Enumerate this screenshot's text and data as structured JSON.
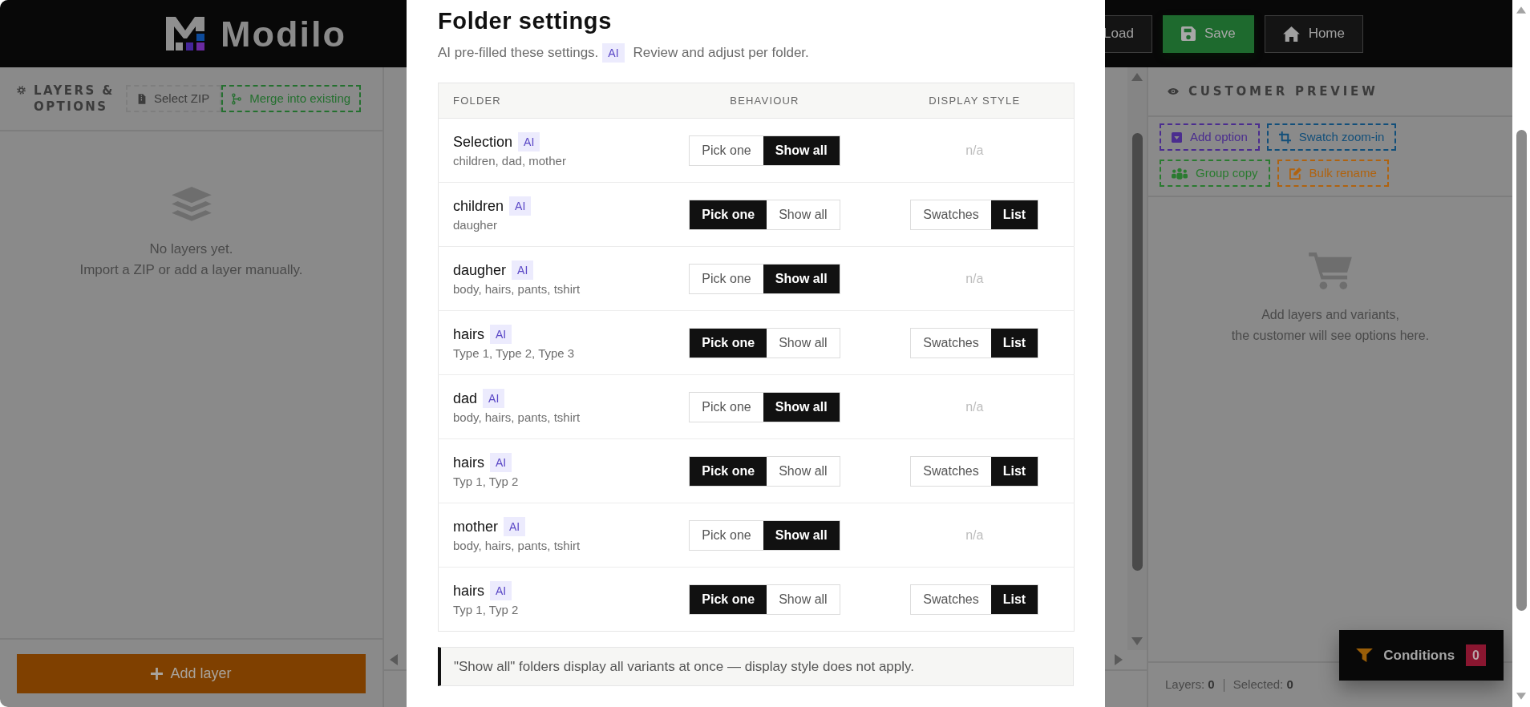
{
  "header": {
    "logo": "Modilo",
    "buttons": [
      {
        "label": "Load",
        "kind": "load"
      },
      {
        "label": "Save",
        "kind": "save"
      },
      {
        "label": "Home",
        "kind": "home"
      }
    ]
  },
  "layers_panel": {
    "title": "LAYERS & OPTIONS",
    "actions": [
      {
        "label": "Select ZIP",
        "kind": "zip"
      },
      {
        "label": "Merge into existing",
        "kind": "merge"
      }
    ],
    "empty_title": "No layers yet.",
    "empty_hint": "Import a ZIP or add a layer manually.",
    "add_button": "Add layer"
  },
  "customer_preview": {
    "title": "CUSTOMER PREVIEW",
    "tools": [
      {
        "label": "Add option",
        "kind": "option",
        "color": "#4b2d8f"
      },
      {
        "label": "Swatch zoom-in",
        "kind": "crop",
        "color": "#124f7a"
      },
      {
        "label": "Group copy",
        "kind": "group",
        "color": "#2a7b30"
      },
      {
        "label": "Bulk rename",
        "kind": "rename",
        "color": "#b0630f"
      }
    ],
    "empty_lines": [
      "Add layers and variants,",
      "the customer will see options here."
    ],
    "status": [
      {
        "label": "Layers:",
        "value": "0"
      },
      {
        "label": "Selected:",
        "value": "0"
      }
    ]
  },
  "conditions": {
    "label": "Conditions",
    "count": "0"
  },
  "modal": {
    "title": "Folder settings",
    "subtitle": "AI pre-filled these settings.",
    "subtitle_badge": "AI",
    "subtitle_end": "Review and adjust per folder.",
    "columns": [
      "FOLDER",
      "BEHAVIOUR",
      "DISPLAY STYLE"
    ],
    "rows": [
      {
        "name": "Selection",
        "badge": "AI",
        "contents": "children, dad, mother",
        "behaviour": [
          {
            "label": "Pick one",
            "selected": false
          },
          {
            "label": "Show all",
            "selected": true
          }
        ],
        "display_style": {
          "kind": "none",
          "text": "n/a"
        }
      },
      {
        "name": "children",
        "badge": "AI",
        "contents": "daugher",
        "behaviour": [
          {
            "label": "Pick one",
            "selected": true
          },
          {
            "label": "Show all",
            "selected": false
          }
        ],
        "display_style": {
          "kind": "toggle",
          "options": [
            {
              "label": "Swatches",
              "selected": false
            },
            {
              "label": "List",
              "selected": true
            }
          ]
        }
      },
      {
        "name": "daugher",
        "badge": "AI",
        "contents": "body, hairs, pants, tshirt",
        "behaviour": [
          {
            "label": "Pick one",
            "selected": false
          },
          {
            "label": "Show all",
            "selected": true
          }
        ],
        "display_style": {
          "kind": "none",
          "text": "n/a"
        }
      },
      {
        "name": "hairs",
        "badge": "AI",
        "contents": "Type 1, Type 2, Type 3",
        "behaviour": [
          {
            "label": "Pick one",
            "selected": true
          },
          {
            "label": "Show all",
            "selected": false
          }
        ],
        "display_style": {
          "kind": "toggle",
          "options": [
            {
              "label": "Swatches",
              "selected": false
            },
            {
              "label": "List",
              "selected": true
            }
          ]
        }
      },
      {
        "name": "dad",
        "badge": "AI",
        "contents": "body, hairs, pants, tshirt",
        "behaviour": [
          {
            "label": "Pick one",
            "selected": false
          },
          {
            "label": "Show all",
            "selected": true
          }
        ],
        "display_style": {
          "kind": "none",
          "text": "n/a"
        }
      },
      {
        "name": "hairs",
        "badge": "AI",
        "contents": "Typ 1, Typ 2",
        "behaviour": [
          {
            "label": "Pick one",
            "selected": true
          },
          {
            "label": "Show all",
            "selected": false
          }
        ],
        "display_style": {
          "kind": "toggle",
          "options": [
            {
              "label": "Swatches",
              "selected": false
            },
            {
              "label": "List",
              "selected": true
            }
          ]
        }
      },
      {
        "name": "mother",
        "badge": "AI",
        "contents": "body, hairs, pants, tshirt",
        "behaviour": [
          {
            "label": "Pick one",
            "selected": false
          },
          {
            "label": "Show all",
            "selected": true
          }
        ],
        "display_style": {
          "kind": "none",
          "text": "n/a"
        }
      },
      {
        "name": "hairs",
        "badge": "AI",
        "contents": "Typ 1, Typ 2",
        "behaviour": [
          {
            "label": "Pick one",
            "selected": true
          },
          {
            "label": "Show all",
            "selected": false
          }
        ],
        "display_style": {
          "kind": "toggle",
          "options": [
            {
              "label": "Swatches",
              "selected": false
            },
            {
              "label": "List",
              "selected": true
            }
          ]
        }
      }
    ],
    "note": "\"Show all\" folders display all variants at once — display style does not apply."
  }
}
